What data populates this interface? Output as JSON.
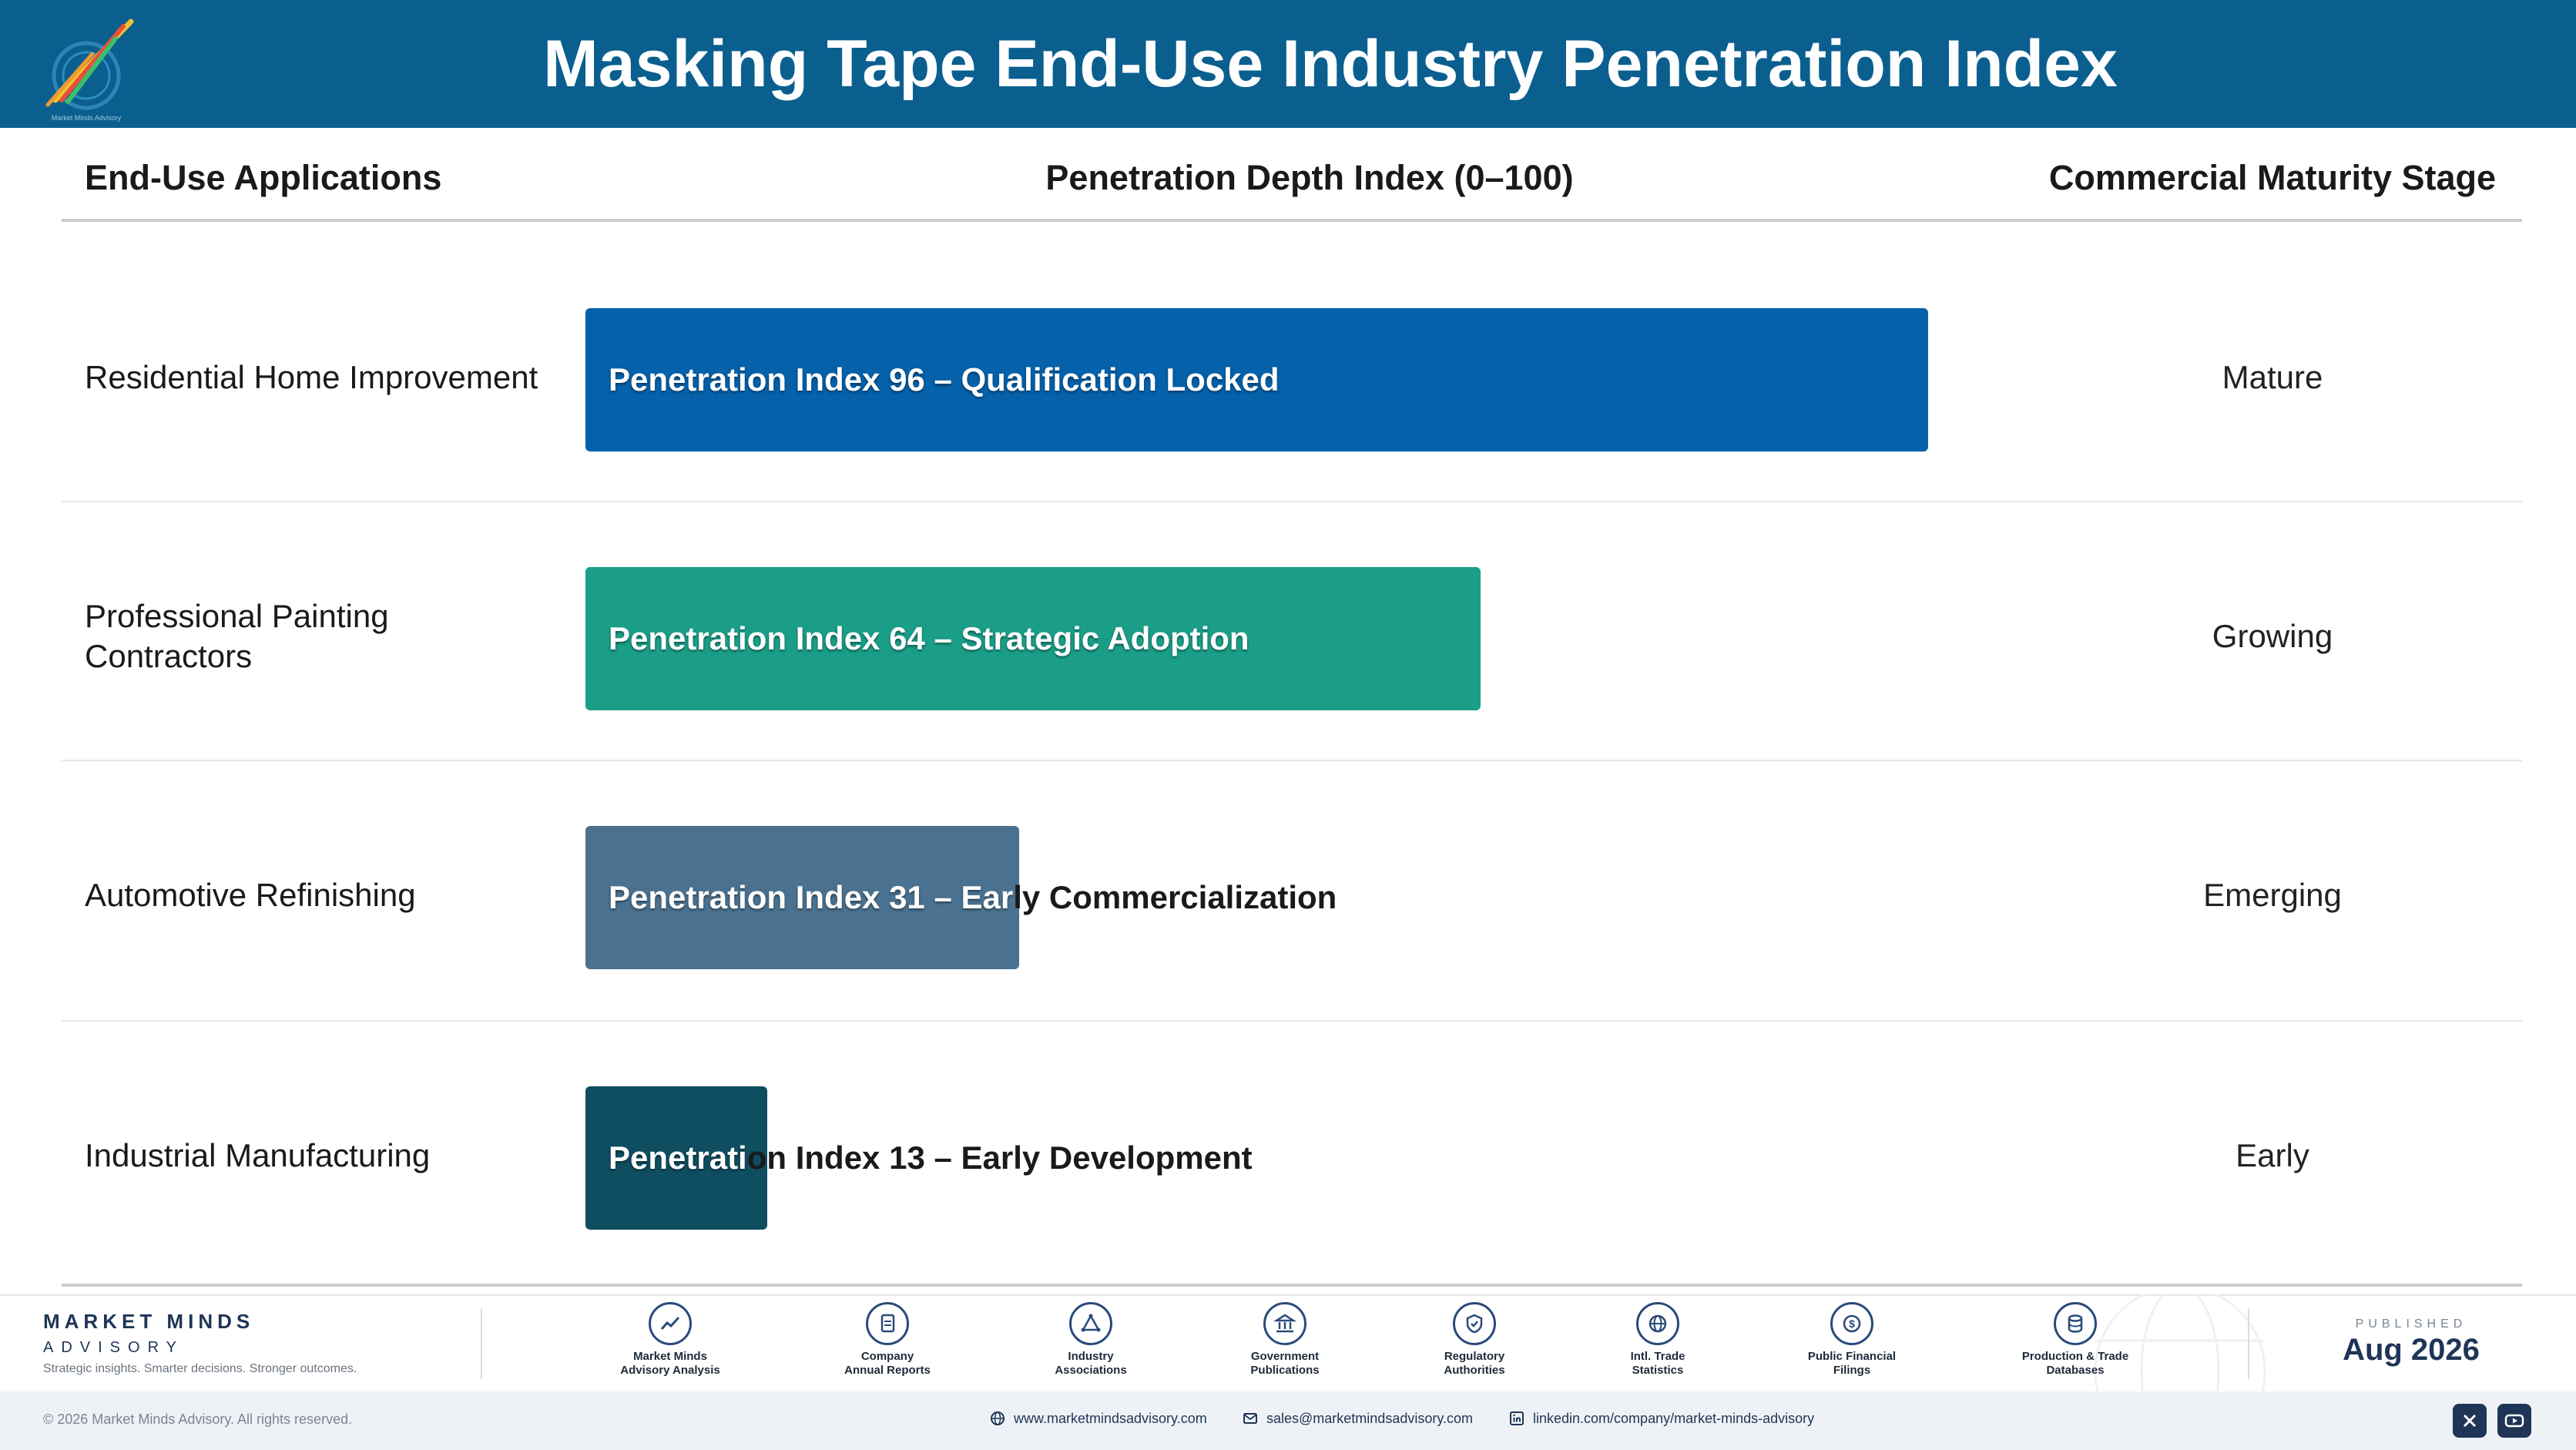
{
  "header": {
    "title": "Masking Tape End-Use Industry Penetration Index"
  },
  "columns": {
    "applications": "End-Use Applications",
    "depth": "Penetration Depth Index (0–100)",
    "stage": "Commercial Maturity Stage"
  },
  "chart_data": {
    "type": "bar",
    "orientation": "horizontal",
    "title": "Masking Tape End-Use Industry Penetration Index",
    "xlim": [
      0,
      100
    ],
    "categories": [
      "Residential Home Improvement",
      "Professional Painting Contractors",
      "Automotive Refinishing",
      "Industrial Manufacturing"
    ],
    "values": [
      96,
      64,
      31,
      13
    ],
    "bar_labels": [
      "Penetration Index 96 – Qualification Locked",
      "Penetration Index 64 – Strategic Adoption",
      "Penetration Index 31 – Early Commercialization",
      "Penetration Index 13 – Early Development"
    ],
    "stages": [
      "Mature",
      "Growing",
      "Emerging",
      "Early"
    ],
    "colors": [
      "#0461aa",
      "#1b9e88",
      "#4a7290",
      "#0e4e60"
    ],
    "grid": false,
    "legend": "none"
  },
  "rows": [
    {
      "label": "Residential Home Improvement",
      "stage": "Mature"
    },
    {
      "label": "Professional Painting Contractors",
      "stage": "Growing"
    },
    {
      "label": "Automotive Refinishing",
      "stage": "Emerging"
    },
    {
      "label": "Industrial Manufacturing",
      "stage": "Early"
    }
  ],
  "footer": {
    "brand_name": "MARKET MINDS",
    "brand_sub": "ADVISORY",
    "brand_tag": "Strategic insights. Smarter decisions. Stronger outcomes.",
    "logo_caption": "Market Minds Advisory",
    "sources": [
      {
        "icon": "chart-line-icon",
        "line1": "Market Minds",
        "line2": "Advisory Analysis"
      },
      {
        "icon": "document-icon",
        "line1": "Company",
        "line2": "Annual Reports"
      },
      {
        "icon": "network-icon",
        "line1": "Industry",
        "line2": "Associations"
      },
      {
        "icon": "building-icon",
        "line1": "Government",
        "line2": "Publications"
      },
      {
        "icon": "shield-icon",
        "line1": "Regulatory",
        "line2": "Authorities"
      },
      {
        "icon": "globe-icon",
        "line1": "Intl. Trade",
        "line2": "Statistics"
      },
      {
        "icon": "dollar-icon",
        "line1": "Public Financial",
        "line2": "Filings"
      },
      {
        "icon": "database-icon",
        "line1": "Production & Trade",
        "line2": "Databases"
      }
    ],
    "published_label": "PUBLISHED",
    "published_date": "Aug 2026",
    "copyright": "© 2026 Market Minds Advisory. All rights reserved.",
    "website": "www.marketmindsadvisory.com",
    "email": "sales@marketmindsadvisory.com",
    "linkedin": "linkedin.com/company/market-minds-advisory"
  }
}
